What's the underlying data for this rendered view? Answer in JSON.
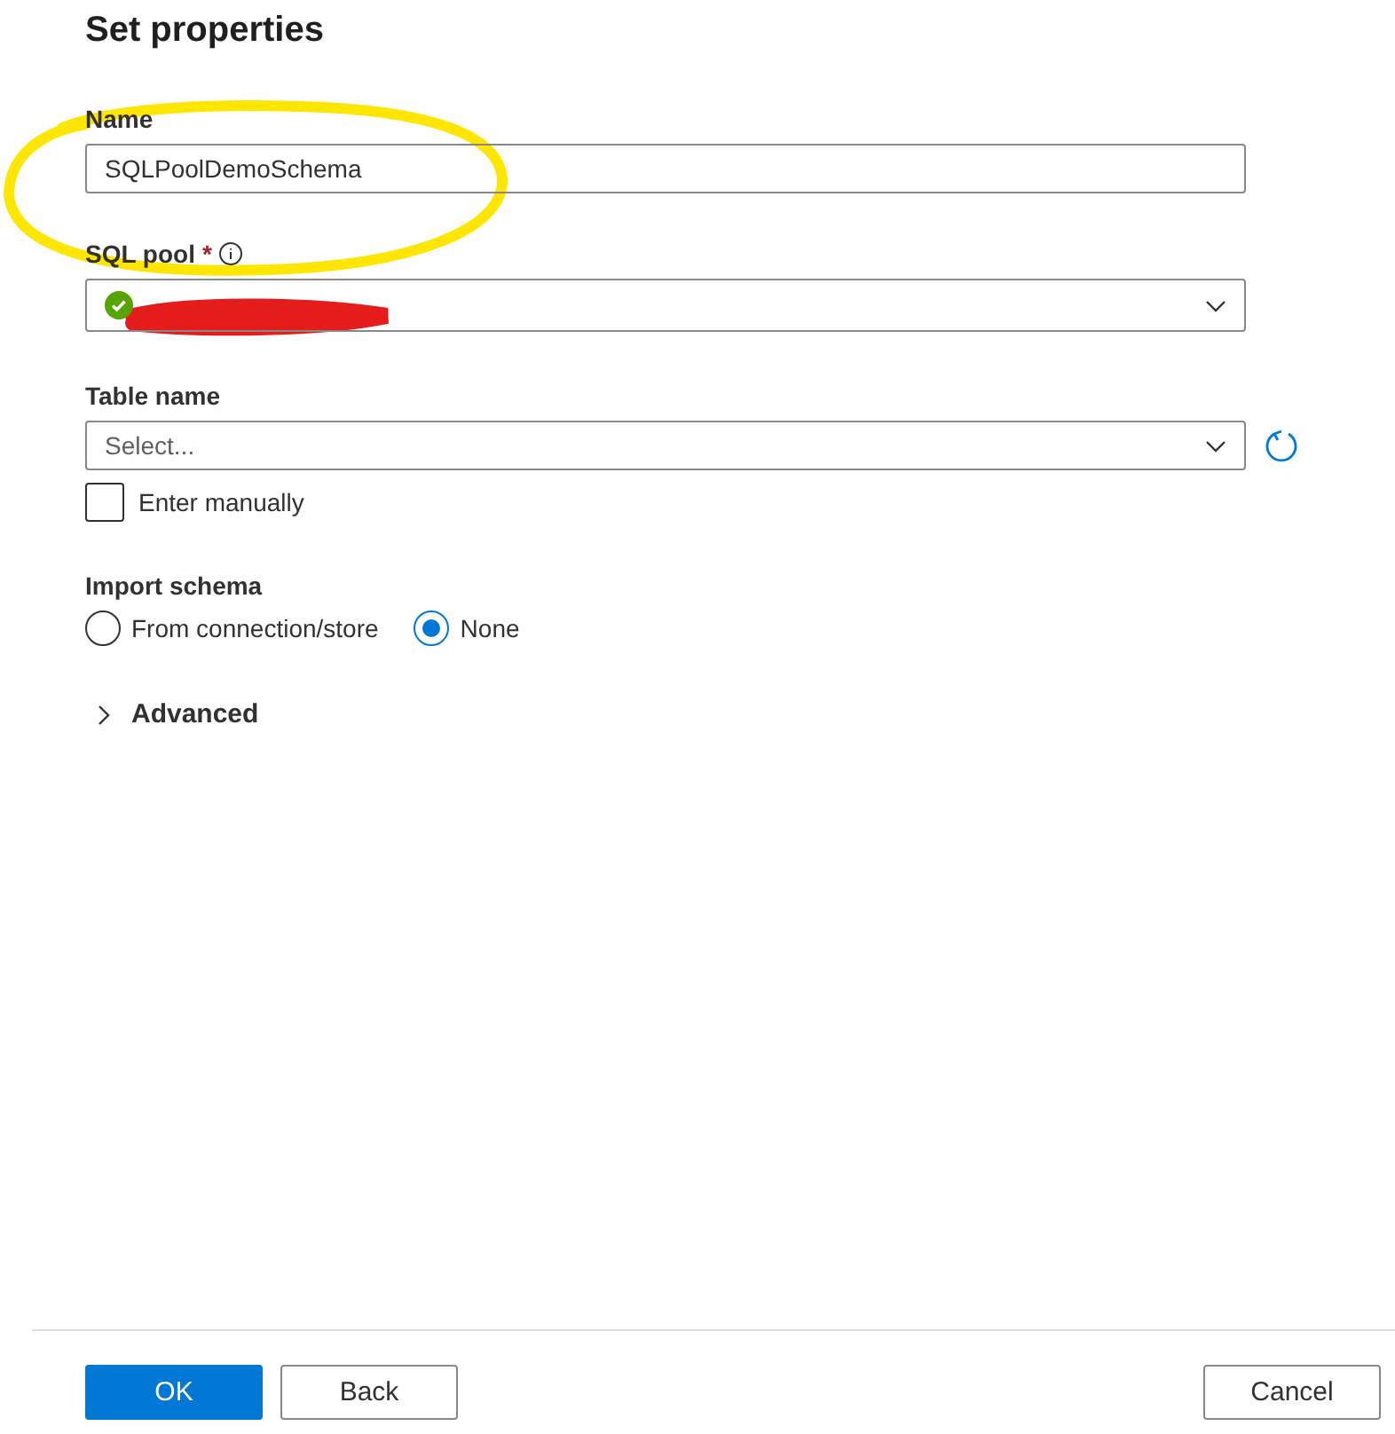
{
  "title": "Set properties",
  "name_field": {
    "label": "Name",
    "value": "SQLPoolDemoSchema"
  },
  "sql_pool": {
    "label": "SQL pool",
    "required_mark": "*"
  },
  "table_name": {
    "label": "Table name",
    "placeholder": "Select..."
  },
  "enter_manually": {
    "label": "Enter manually",
    "checked": false
  },
  "import_schema": {
    "label": "Import schema",
    "options": [
      {
        "label": "From connection/store",
        "selected": false
      },
      {
        "label": "None",
        "selected": true
      }
    ]
  },
  "advanced": {
    "label": "Advanced",
    "expanded": false
  },
  "footer": {
    "left_buttons": [
      {
        "label": "OK",
        "kind": "primary"
      },
      {
        "label": "Back",
        "kind": "secondary"
      }
    ],
    "right_buttons": [
      {
        "label": "Cancel",
        "kind": "secondary"
      }
    ]
  }
}
